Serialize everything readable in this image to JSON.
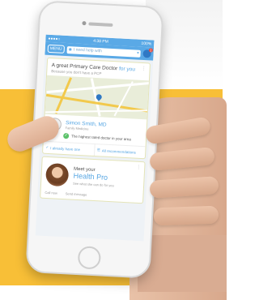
{
  "status_bar": {
    "carrier": "●●●●○",
    "time": "4:38 PM",
    "battery": "100%"
  },
  "nav": {
    "menu_label": "MENU",
    "location_placeholder": "I need help with",
    "notification_count": "2"
  },
  "doctor_card": {
    "title_prefix": "A great Primary Care Doctor",
    "title_accent": "for you",
    "subtitle": "Because you don't have a PCP",
    "doctor_name": "Simon Smith, MD",
    "doctor_specialty": "Family Medicine",
    "rating_text": "The highest rated doctor in your area",
    "action_have_one": "I already have one",
    "action_all_recommendations": "All recommendations"
  },
  "pro_card": {
    "meet": "Meet your",
    "title": "Health Pro",
    "description": "See what she can do for you",
    "footer_left": "Call now",
    "footer_right": "Send message"
  },
  "colors": {
    "brand_blue": "#5aa9e6",
    "accent_blue": "#56a6e3",
    "background_yellow": "#f8bf37"
  }
}
